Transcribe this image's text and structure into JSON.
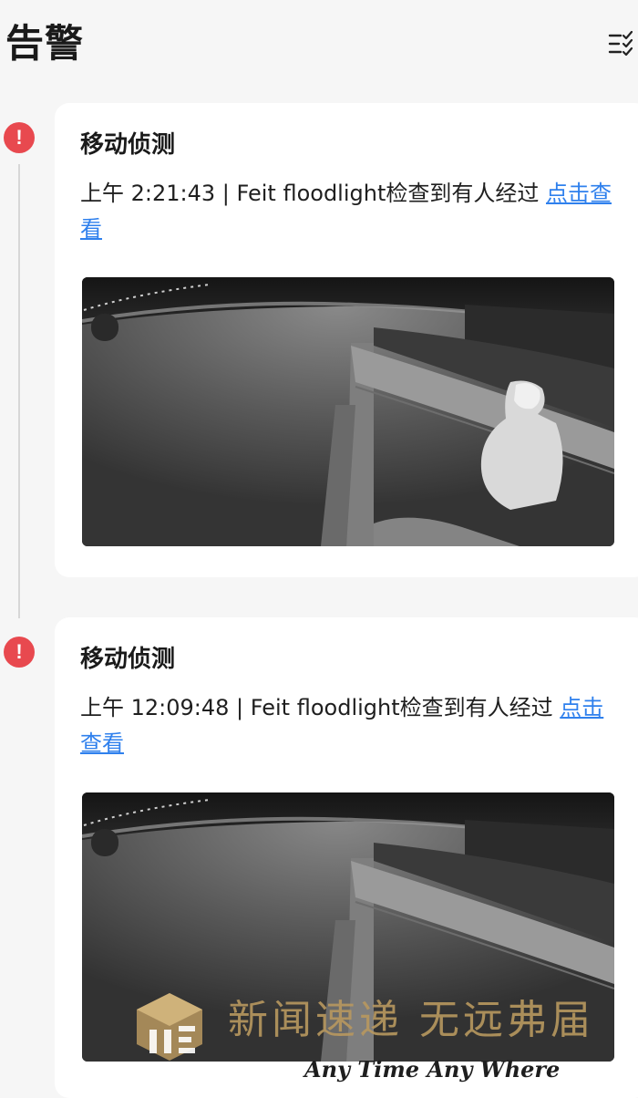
{
  "header": {
    "title": "告警",
    "filter_icon": "list-check-icon"
  },
  "alerts": [
    {
      "icon": "exclamation-icon",
      "title": "移动侦测",
      "description": "上午 2:21:43 | Feit floodlight检查到有人经过 ",
      "link_label": "点击查看",
      "snapshot": "night-camera-snapshot-person"
    },
    {
      "icon": "exclamation-icon",
      "title": "移动侦测",
      "description": "上午 12:09:48 | Feit floodlight检查到有人经过 ",
      "link_label": "点击查看",
      "snapshot": "night-camera-snapshot"
    }
  ],
  "watermark": {
    "chinese": "新闻速递  无远弗届",
    "english": "Any Time  Any Where"
  },
  "colors": {
    "background": "#f6f6f6",
    "card": "#ffffff",
    "alert_red": "#e8494f",
    "link_blue": "#2f80ed",
    "watermark_gold": "#b8985f"
  }
}
